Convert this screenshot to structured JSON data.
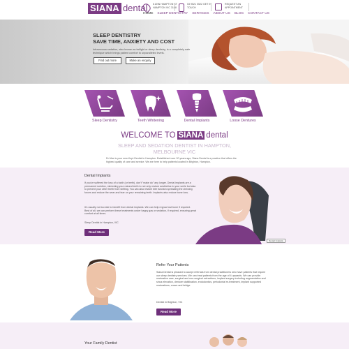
{
  "header": {
    "logo_box": "SIANA",
    "logo_rest": "dental",
    "address": "6 ANN HAMPTON ST HAMPTON VIC 3188",
    "phone": "03 9521 0522 GET IN TOUCH",
    "appointment": "REQUEST AN APPOINTMENT",
    "nav": [
      "HOME",
      "SLEEP DENTISTRY",
      "SERVICES",
      "ABOUT US",
      "BLOG",
      "CONTACT US"
    ]
  },
  "hero": {
    "title_line1": "SLEEP DENTISTRY",
    "title_line2": "SAVE TIME, ANXIETY AND COST",
    "body": "Intravenous sedation, also known as twilight or sleep dentistry, is a completely safe technique which brings patient comfort to unparalleled levels.",
    "btn_find": "Find out more",
    "btn_enquiry": "Make an enquiry"
  },
  "services": [
    {
      "label": "Sleep Dentistry",
      "icon": "dental-chair-icon"
    },
    {
      "label": "Teeth Whitening",
      "icon": "sparkling-tooth-icon"
    },
    {
      "label": "Dental Implants",
      "icon": "implant-icon"
    },
    {
      "label": "Loose Dentures",
      "icon": "dentures-icon"
    }
  ],
  "welcome": {
    "title_prefix": "WELCOME TO",
    "title_box": "SIANA",
    "title_rest": "dental",
    "subtitle": "SLEEP AND SEDATION DENTIST IN HAMPTON, MELBOURNE VIC",
    "body": "Dr Max is your new-Kept Dentist in Hampton. Established over 20 years ago, Siana Dental is a practice that offers the highest quality of care and service. We are here to help patients located in Brighton, Hampton."
  },
  "implants": {
    "heading": "Dental Implants",
    "body1": "If you've suffered the loss of a tooth (or teeth), don't \"make do\" any longer. Dental implants are a permanent solution, mimicking your natural teeth to not only restore aesthetics to your smile but also to prevent your other teeth from shifting. You can also restore bite function spreading the chewing forces and reduce the wear and tear on your remaining teeth. Implants also reduce bone loss.",
    "body2": "It's usually not too late to benefit from dental implants. We can help regrow lost bone if required. Best of all, we can perform these treatments under happy gas or sedation, if required, ensuring great comfort at all times.",
    "location": "Sleep Dentist in Hampton, VIC",
    "button": "Read More",
    "tag": "Dental Implants"
  },
  "refer": {
    "heading": "Refer Your Patients",
    "body": "Siana Dental is pleased to accept referrals from dental practitioners who have patients that require our sleep dentistry services. We can treat patients from the age of 4 upwards. We can provide restorative care, surgical and non-surgical extractions, implant surgery including augmentation and sinus elevation, denture stabilisation, endodontics, periodontal re-treatment, implant supported restorations, crown and bridge.",
    "location": "Dentist in Brighton, VIC",
    "button": "Read More"
  },
  "family": {
    "heading": "Your Family Dentist"
  },
  "colors": {
    "brand": "#7b3b84",
    "section_bg": "#f6eef7",
    "button": "#6e2f7a"
  }
}
